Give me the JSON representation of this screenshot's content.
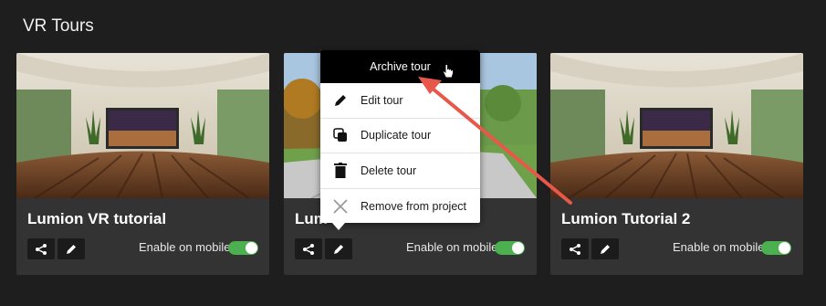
{
  "section": {
    "title": "VR Tours"
  },
  "cards": [
    {
      "title": "Lumion VR tutorial",
      "mobile_label": "Enable on mobile",
      "mobile_enabled": true
    },
    {
      "title": "Lum",
      "mobile_label": "Enable on mobile",
      "mobile_enabled": true
    },
    {
      "title": "Lumion Tutorial 2",
      "mobile_label": "Enable on mobile",
      "mobile_enabled": true
    }
  ],
  "menu": {
    "header": "Archive tour",
    "items": [
      {
        "label": "Edit tour",
        "icon": "pencil-icon"
      },
      {
        "label": "Duplicate tour",
        "icon": "duplicate-icon"
      },
      {
        "label": "Delete tour",
        "icon": "trash-icon"
      },
      {
        "label": "Remove from project",
        "icon": "close-icon"
      }
    ]
  },
  "colors": {
    "background": "#1e1e1e",
    "card": "#333333",
    "toggle_on": "#4caf50",
    "annotation_arrow": "#e8584a"
  }
}
